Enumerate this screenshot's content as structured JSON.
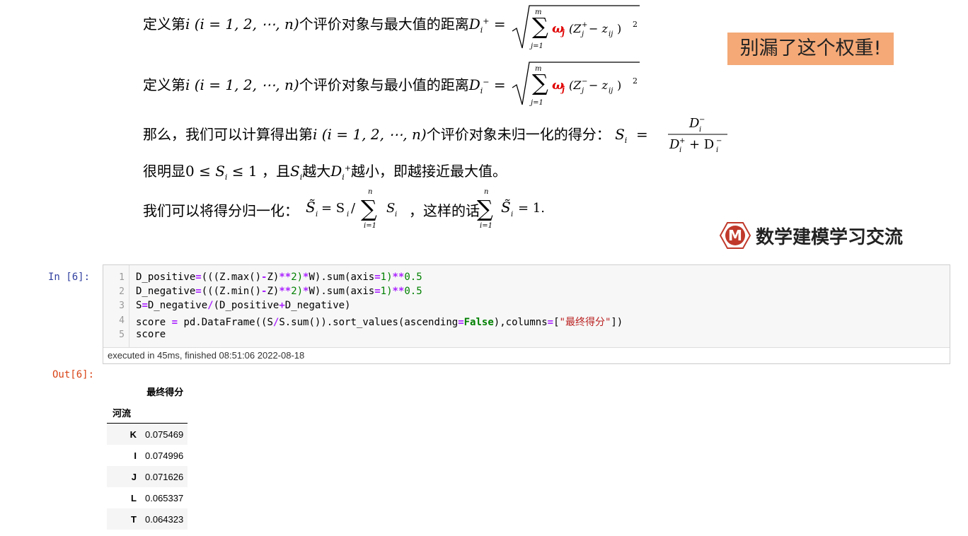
{
  "slide": {
    "line1_prefix": "定义第",
    "line1_mid": "个评价对象与最大值的距离",
    "line2_prefix": "定义第",
    "line2_mid": "个评价对象与最小值的距离",
    "index_expr": "i (i = 1, 2, ⋯, n)",
    "dplus": "D",
    "line3_text": "那么，我们可以计算得出第",
    "line3_mid": "个评价对象未归一化的得分：",
    "line4_text_a": "很明显",
    "line4_text_b": "，且",
    "line4_text_c": "越大",
    "line4_text_d": "越小，即越接近最大值。",
    "line5_text_a": "我们可以将得分归一化：",
    "line5_text_b": "，这样的话",
    "callout": "别漏了这个权重!",
    "logo_text": "数学建模学习交流",
    "logo_letter": "M"
  },
  "notebook": {
    "in_prompt": "In  [6]:",
    "out_prompt": "Out[6]:",
    "line_numbers": [
      "1",
      "2",
      "3",
      "4",
      "5"
    ],
    "exec_info": "executed in 45ms, finished 08:51:06 2022-08-18",
    "code": {
      "l1_a": "D_positive",
      "l1_b": "(((Z.max()",
      "l1_c": "Z)",
      "l1_d": "2)",
      "l1_e": "W).sum(axis",
      "l1_f": "1)",
      "l1_g": "0.5",
      "l2_a": "D_negative",
      "l2_b": "(((Z.min()",
      "l2_c": "Z)",
      "l2_d": "2)",
      "l2_e": "W).sum(axis",
      "l2_f": "1)",
      "l2_g": "0.5",
      "l3_a": "S",
      "l3_b": "D_negative",
      "l3_c": "(D_positive",
      "l3_d": "D_negative)",
      "l4_a": "score ",
      "l4_b": " pd.DataFrame((S",
      "l4_c": "S.sum()).sort_values(ascending",
      "l4_d": "False",
      "l4_e": "),columns",
      "l4_f": "[",
      "l4_g": "\"最终得分\"",
      "l4_h": "])",
      "l5": "score"
    },
    "table": {
      "col_header": "最终得分",
      "index_name": "河流",
      "rows": [
        {
          "idx": "K",
          "val": "0.075469"
        },
        {
          "idx": "I",
          "val": "0.074996"
        },
        {
          "idx": "J",
          "val": "0.071626"
        },
        {
          "idx": "L",
          "val": "0.065337"
        },
        {
          "idx": "T",
          "val": "0.064323"
        }
      ]
    }
  },
  "colors": {
    "callout_bg": "#f4a977",
    "weight_red": "#e00000",
    "logo_red": "#c0392b"
  }
}
